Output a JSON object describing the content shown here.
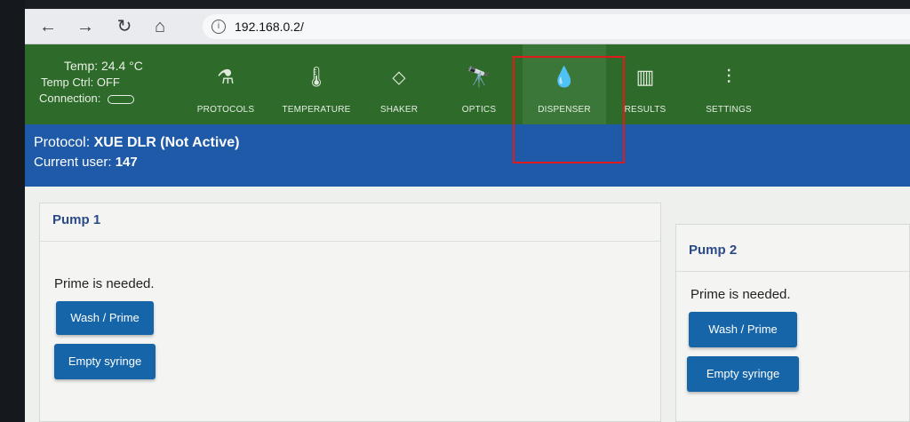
{
  "browser": {
    "back_icon": "←",
    "forward_icon": "→",
    "refresh_icon": "↻",
    "home_icon": "⌂",
    "info_icon": "i",
    "url": "192.168.0.2/"
  },
  "status": {
    "temp": "Temp: 24.4 °C",
    "temp_ctrl": "Temp Ctrl: OFF",
    "connection": "Connection:"
  },
  "nav": {
    "items": [
      {
        "label": "PROTOCOLS",
        "icon": "⚗"
      },
      {
        "label": "TEMPERATURE",
        "icon": "🌡"
      },
      {
        "label": "SHAKER",
        "icon": "⬦"
      },
      {
        "label": "OPTICS",
        "icon": "🔭"
      },
      {
        "label": "DISPENSER",
        "icon": "💧"
      },
      {
        "label": "RESULTS",
        "icon": "▥"
      },
      {
        "label": "SETTINGS",
        "icon": "⫶"
      }
    ],
    "active": "DISPENSER"
  },
  "protocol": {
    "label": "Protocol:",
    "name": "XUE DLR (Not Active)"
  },
  "user": {
    "label": "Current user:",
    "id": "147"
  },
  "pumps": [
    {
      "title": "Pump 1",
      "message": "Prime is needed.",
      "wash_label": "Wash / Prime",
      "empty_label": "Empty syringe"
    },
    {
      "title": "Pump 2",
      "message": "Prime is needed.",
      "wash_label": "Wash / Prime",
      "empty_label": "Empty syringe"
    }
  ],
  "colors": {
    "header_green": "#2e6a2a",
    "protocol_blue": "#1e5aa8",
    "button_blue": "#1565a8",
    "highlight_red": "#e11b1b"
  }
}
